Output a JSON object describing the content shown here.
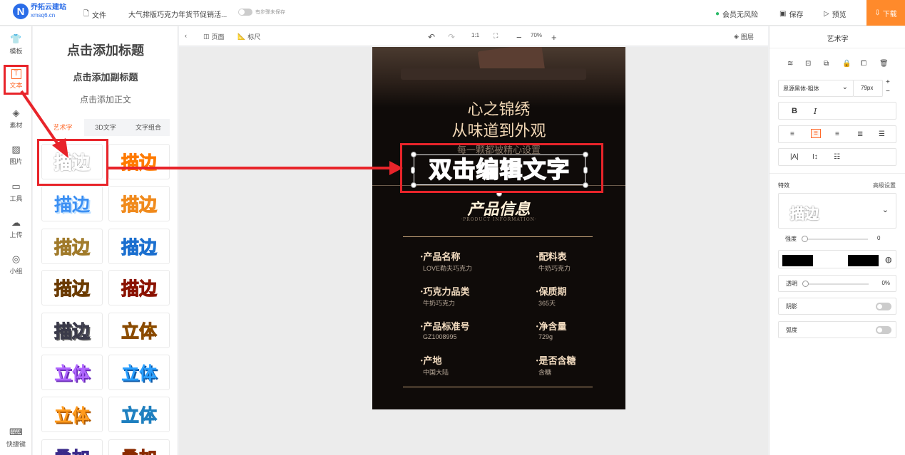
{
  "brand": {
    "name": "乔拓云建站",
    "domain": "xmsq6.cn"
  },
  "topbar": {
    "file_label": "文件",
    "doc_title": "大气排版巧克力年货节促销活...",
    "save_toggle_label": "有步骤未保存",
    "member_label": "会员无风险",
    "save_label": "保存",
    "preview_label": "预览",
    "download_label": "下载"
  },
  "sidebar": {
    "items": [
      {
        "label": "模板",
        "icon": "template-icon"
      },
      {
        "label": "文本",
        "icon": "text-icon"
      },
      {
        "label": "素材",
        "icon": "material-icon"
      },
      {
        "label": "图片",
        "icon": "image-icon"
      },
      {
        "label": "工具",
        "icon": "toolbox-icon"
      },
      {
        "label": "上传",
        "icon": "upload-cloud-icon"
      },
      {
        "label": "小组",
        "icon": "group-icon"
      }
    ],
    "shortcut_label": "快捷键"
  },
  "text_panel": {
    "add_title": "点击添加标题",
    "add_subtitle": "点击添加副标题",
    "add_body": "点击添加正文",
    "tabs": [
      "艺术字",
      "3D文字",
      "文字组合"
    ],
    "styles": [
      "描边",
      "描边",
      "描边",
      "描边",
      "描边",
      "描边",
      "描边",
      "描边",
      "描边",
      "描边",
      "描边",
      "立体",
      "立体",
      "立体",
      "立体",
      "立体",
      "叠加",
      "叠加"
    ]
  },
  "canvas_toolbar": {
    "page_label": "页面",
    "ruler_label": "标尺",
    "ratio_label": "1:1",
    "zoom": "70%",
    "layers_label": "图层"
  },
  "poster": {
    "headline_1": "心之锦绣",
    "headline_2": "从味道到外观",
    "tagline": "每一颗都被精心设置",
    "selected_text": "双击编辑文字",
    "section_title": "产品信息",
    "section_sub": "·PRODUCT INFORMATION·",
    "info": [
      {
        "label": "·产品名称",
        "value": "LOVE勒夫巧克力"
      },
      {
        "label": "·配料表",
        "value": "牛奶巧克力"
      },
      {
        "label": "·巧克力品类",
        "value": "牛奶巧克力"
      },
      {
        "label": "·保质期",
        "value": "365天"
      },
      {
        "label": "·产品标准号",
        "value": "GZ1008995"
      },
      {
        "label": "·净含量",
        "value": "729g"
      },
      {
        "label": "·产地",
        "value": "中国大陆"
      },
      {
        "label": "·是否含糖",
        "value": "含糖"
      }
    ]
  },
  "right_panel": {
    "title": "艺术字",
    "font_family": "思源黑体-粗体",
    "font_size": "79px",
    "effects_label": "特效",
    "advanced_label": "高级设置",
    "effect_name": "描边",
    "strength_label": "强度",
    "strength_value": "0",
    "opacity_label": "透明",
    "opacity_value": "0%",
    "shadow_label": "阴影",
    "arc_label": "弧度"
  },
  "colors": {
    "accent": "#ff6a2b",
    "annotation": "#e8242a",
    "brand": "#2b6de8",
    "poster_bg": "#0f0b09",
    "gold": "#c9a67d"
  }
}
